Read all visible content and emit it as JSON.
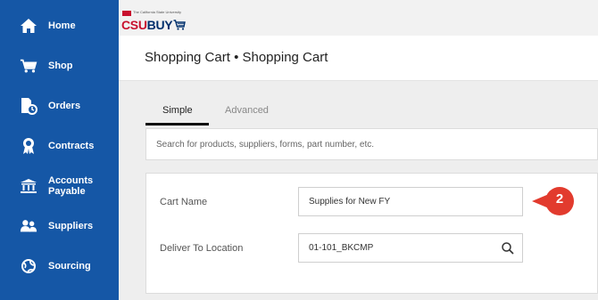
{
  "sidebar": {
    "items": [
      {
        "label": "Home",
        "icon": "home-icon"
      },
      {
        "label": "Shop",
        "icon": "cart-icon"
      },
      {
        "label": "Orders",
        "icon": "orders-icon"
      },
      {
        "label": "Contracts",
        "icon": "award-icon"
      },
      {
        "label": "Accounts Payable",
        "icon": "bank-icon"
      },
      {
        "label": "Suppliers",
        "icon": "people-icon"
      },
      {
        "label": "Sourcing",
        "icon": "sourcing-icon"
      }
    ],
    "background": "#1557a6"
  },
  "logo": {
    "small_text": "The California State University",
    "csu": "CSU",
    "buy": "BUY"
  },
  "header": {
    "title": "Shopping Cart  •  Shopping Cart"
  },
  "tabs": [
    {
      "label": "Simple",
      "active": true
    },
    {
      "label": "Advanced",
      "active": false
    }
  ],
  "search": {
    "placeholder": "Search for products, suppliers, forms, part number, etc."
  },
  "form": {
    "cart_name": {
      "label": "Cart Name",
      "value": "Supplies for New FY"
    },
    "deliver_to": {
      "label": "Deliver To Location",
      "value": "01-101_BKCMP"
    }
  },
  "callout": {
    "number": "2",
    "color": "#e23b2e"
  }
}
